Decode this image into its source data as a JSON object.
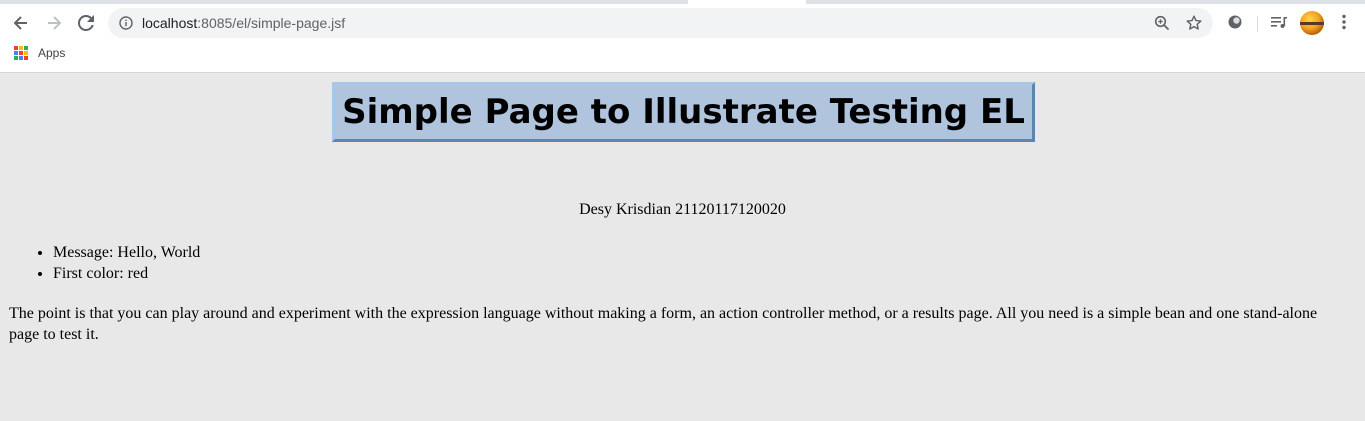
{
  "browser": {
    "url_host": "localhost",
    "url_path": ":8085/el/simple-page.jsf",
    "bookmarks": [
      {
        "label": "Apps"
      }
    ],
    "apps_grid_colors": [
      "#ea4335",
      "#fbbc05",
      "#34a853",
      "#4285f4",
      "#ea4335",
      "#fbbc05",
      "#34a853",
      "#4285f4",
      "#ea4335"
    ]
  },
  "page": {
    "title": "Simple Page to Illustrate Testing EL",
    "author": "Desy Krisdian 21120117120020",
    "items": [
      "Message: Hello, World",
      "First color: red"
    ],
    "paragraph": "The point is that you can play around and experiment with the expression language without making a form, an action controller method, or a results page. All you need is a simple bean and one stand-alone page to test it.",
    "colors": {
      "background": "#e8e8e8",
      "title_background": "#b0c4de",
      "title_border_dark": "#5f85ad"
    }
  }
}
